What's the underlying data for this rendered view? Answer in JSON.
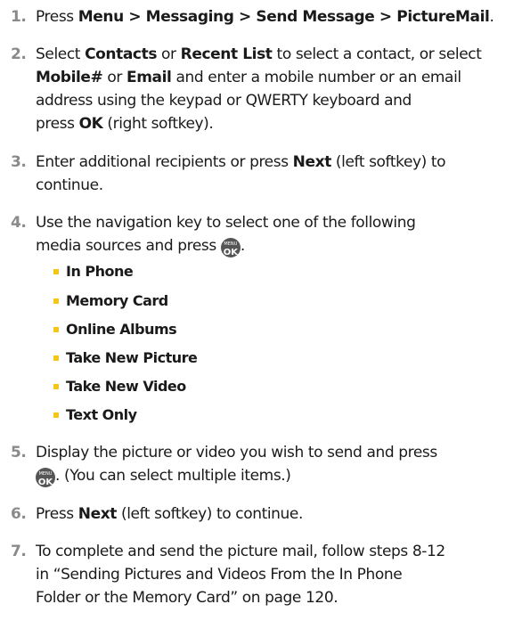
{
  "steps": [
    {
      "num": "1.",
      "parts": [
        {
          "t": "Press "
        },
        {
          "t": "Menu > Messaging > Send Message > PictureMail",
          "b": true
        },
        {
          "t": "."
        }
      ]
    },
    {
      "num": "2.",
      "parts": [
        {
          "t": "Select "
        },
        {
          "t": "Contacts",
          "b": true
        },
        {
          "t": " or "
        },
        {
          "t": "Recent List",
          "b": true
        },
        {
          "t": " to select a contact, or select"
        },
        {
          "br": true
        },
        {
          "t": "Mobile#",
          "b": true
        },
        {
          "t": " or "
        },
        {
          "t": "Email",
          "b": true
        },
        {
          "t": " and enter a mobile number or an email"
        },
        {
          "br": true
        },
        {
          "t": "address using the keypad or QWERTY keyboard and"
        },
        {
          "br": true
        },
        {
          "t": "press "
        },
        {
          "t": "OK",
          "b": true
        },
        {
          "t": " (right softkey)."
        }
      ]
    },
    {
      "num": "3.",
      "parts": [
        {
          "t": "Enter additional recipients or press "
        },
        {
          "t": "Next",
          "b": true
        },
        {
          "t": " (left softkey) to"
        },
        {
          "br": true
        },
        {
          "t": "continue."
        }
      ]
    },
    {
      "num": "4.",
      "parts": [
        {
          "t": "Use the navigation key to select one of the following"
        },
        {
          "br": true
        },
        {
          "t": "media sources and press "
        },
        {
          "icon": "menu-ok-key-icon"
        },
        {
          "t": "."
        }
      ]
    },
    {
      "num": "5.",
      "parts": [
        {
          "t": "Display the picture or video you wish to send and press"
        },
        {
          "br": true
        },
        {
          "icon": "menu-ok-key-icon"
        },
        {
          "t": ". (You can select multiple items.)"
        }
      ]
    },
    {
      "num": "6.",
      "parts": [
        {
          "t": "Press "
        },
        {
          "t": "Next",
          "b": true
        },
        {
          "t": " (left softkey) to continue."
        }
      ]
    },
    {
      "num": "7.",
      "parts": [
        {
          "t": "To complete and send the picture mail, follow steps 8-12"
        },
        {
          "br": true
        },
        {
          "t": "in “Sending Pictures and Videos From the In Phone"
        },
        {
          "br": true
        },
        {
          "t": "Folder or the Memory Card” on page 120."
        }
      ]
    }
  ],
  "media_sources": [
    "In Phone",
    "Memory Card",
    "Online Albums",
    "Take New Picture",
    "Take New Video",
    "Text Only"
  ],
  "ok_key": {
    "top": "MENU",
    "bottom": "OK"
  },
  "colors": {
    "number": "#8a8a8a",
    "bullet": "#f5c518",
    "key_bg": "#555555"
  }
}
